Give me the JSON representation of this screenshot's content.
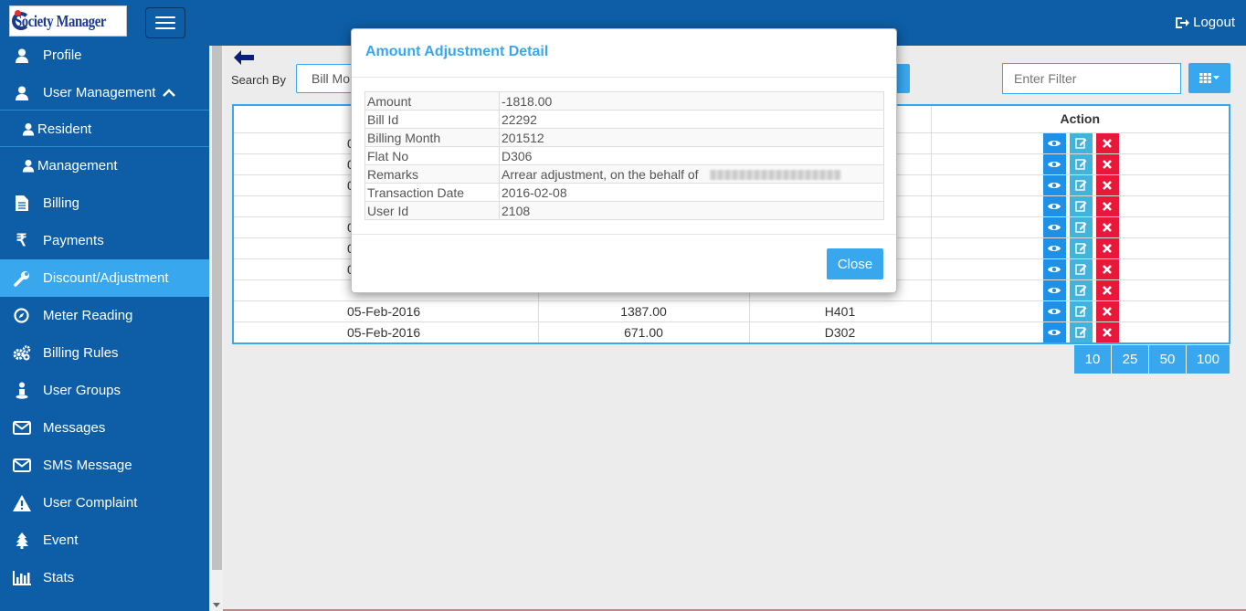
{
  "header": {
    "logo_text": "Society Manager",
    "logout_label": "Logout"
  },
  "sidebar": {
    "items": [
      {
        "label": "Profile",
        "icon": "user-icon"
      },
      {
        "label": "User Management",
        "icon": "user-icon"
      },
      {
        "label": "Resident",
        "icon": "user-icon"
      },
      {
        "label": "Management",
        "icon": "user-icon"
      },
      {
        "label": "Billing",
        "icon": "file-icon"
      },
      {
        "label": "Payments",
        "icon": "rupee-icon"
      },
      {
        "label": "Discount/Adjustment",
        "icon": "wrench-icon"
      },
      {
        "label": "Meter Reading",
        "icon": "compass-icon"
      },
      {
        "label": "Billing Rules",
        "icon": "gears-icon"
      },
      {
        "label": "User Groups",
        "icon": "user-group-icon"
      },
      {
        "label": "Messages",
        "icon": "envelope-icon"
      },
      {
        "label": "SMS Message",
        "icon": "envelope-icon"
      },
      {
        "label": "User Complaint",
        "icon": "warning-icon"
      },
      {
        "label": "Event",
        "icon": "tree-icon"
      },
      {
        "label": "Stats",
        "icon": "bar-chart-icon"
      }
    ],
    "active_item": "Discount/Adjustment"
  },
  "toolbar": {
    "search_by_label": "Search By",
    "search_select_value": "Bill Mo",
    "filter_placeholder": "Enter Filter"
  },
  "grid": {
    "action_header": "Action",
    "rows": [
      {
        "date": "0",
        "amount": "",
        "flat": ""
      },
      {
        "date": "0",
        "amount": "",
        "flat": ""
      },
      {
        "date": "0",
        "amount": "",
        "flat": ""
      },
      {
        "date": "",
        "amount": "",
        "flat": ""
      },
      {
        "date": "0",
        "amount": "",
        "flat": ""
      },
      {
        "date": "0",
        "amount": "",
        "flat": ""
      },
      {
        "date": "0",
        "amount": "",
        "flat": ""
      },
      {
        "date": "",
        "amount": "",
        "flat": ""
      },
      {
        "date": "05-Feb-2016",
        "amount": "1387.00",
        "flat": "H401"
      },
      {
        "date": "05-Feb-2016",
        "amount": "671.00",
        "flat": "D302"
      }
    ]
  },
  "pagination": {
    "sizes": [
      "10",
      "25",
      "50",
      "100"
    ],
    "selected": "10"
  },
  "modal": {
    "title": "Amount Adjustment Detail",
    "fields": [
      {
        "key": "Amount",
        "value": "-1818.00"
      },
      {
        "key": "Bill Id",
        "value": "22292"
      },
      {
        "key": "Billing Month",
        "value": "201512"
      },
      {
        "key": "Flat No",
        "value": "D306"
      },
      {
        "key": "Remarks",
        "value": "Arrear adjustment, on the behalf of"
      },
      {
        "key": "Transaction Date",
        "value": "2016-02-08"
      },
      {
        "key": "User Id",
        "value": "2108"
      }
    ],
    "close_label": "Close"
  },
  "colors": {
    "nav_blue": "#0d5ea6",
    "accent": "#39a7ee",
    "delete_red": "#e8183a"
  }
}
